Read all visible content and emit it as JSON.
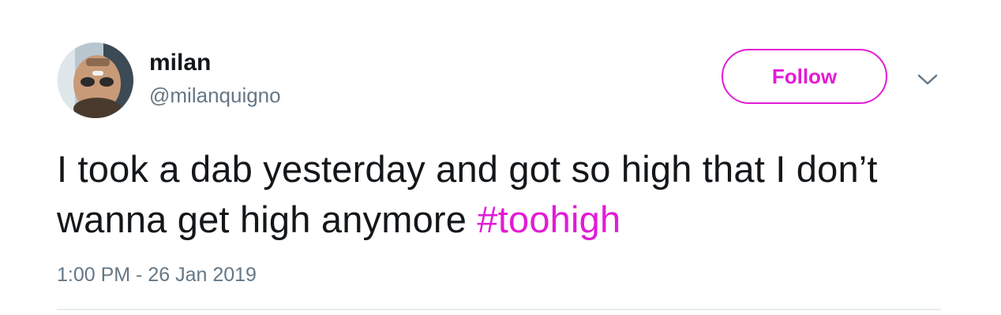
{
  "user": {
    "display_name": "milan",
    "handle": "@milanquigno"
  },
  "actions": {
    "follow_label": "Follow",
    "menu_icon": "chevron-down-icon"
  },
  "tweet": {
    "text": "I took a dab yesterday and got so high that I don’t wanna get high anymore ",
    "hashtag": "#toohigh",
    "timestamp": "1:00 PM - 26 Jan 2019"
  },
  "colors": {
    "accent": "#e21bd6",
    "secondary_text": "#657786",
    "primary_text": "#14171a"
  }
}
